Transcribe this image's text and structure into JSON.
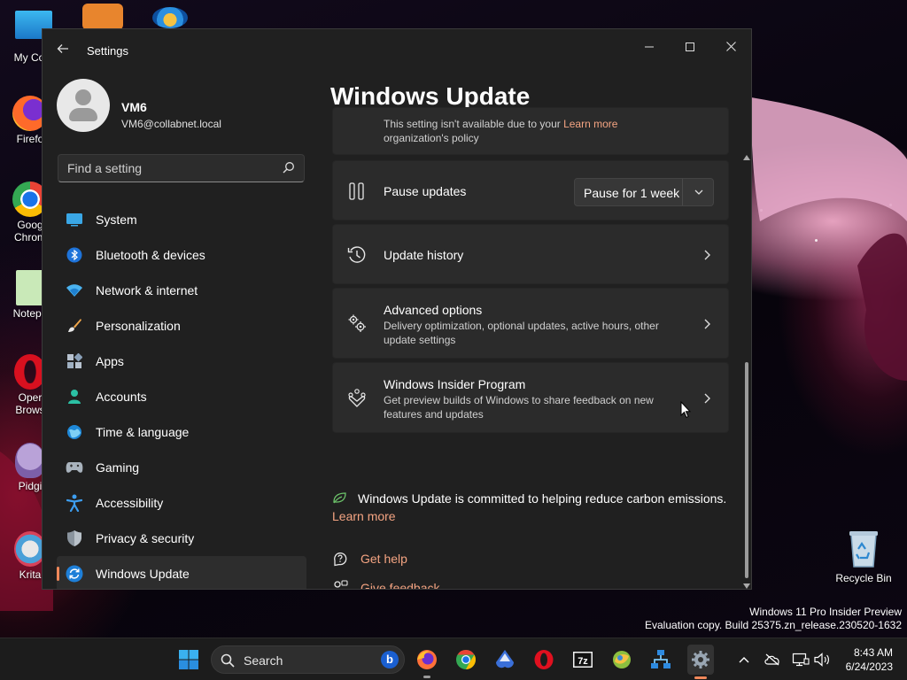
{
  "desktop": {
    "icons": [
      {
        "label": "My Com"
      },
      {
        "label": "Firefo"
      },
      {
        "label": "Goog Chrom"
      },
      {
        "label": "Notepa"
      },
      {
        "label": "Oper Brows"
      },
      {
        "label": "Pidgi"
      },
      {
        "label": "Krita"
      },
      {
        "label": "Recycle Bin"
      }
    ],
    "watermark": {
      "line1": "Windows 11 Pro Insider Preview",
      "line2": "Evaluation copy. Build 25375.zn_release.230520-1632"
    }
  },
  "window": {
    "title": "Settings",
    "controls": {
      "minimize": "minimize",
      "maximize": "maximize",
      "close": "close"
    }
  },
  "user": {
    "name": "VM6",
    "email": "VM6@collabnet.local"
  },
  "search": {
    "placeholder": "Find a setting"
  },
  "nav": [
    {
      "label": "System",
      "icon": "system-icon"
    },
    {
      "label": "Bluetooth & devices",
      "icon": "bluetooth-icon"
    },
    {
      "label": "Network & internet",
      "icon": "network-icon"
    },
    {
      "label": "Personalization",
      "icon": "brush-icon"
    },
    {
      "label": "Apps",
      "icon": "apps-icon"
    },
    {
      "label": "Accounts",
      "icon": "accounts-icon"
    },
    {
      "label": "Time & language",
      "icon": "globe-icon"
    },
    {
      "label": "Gaming",
      "icon": "gamepad-icon"
    },
    {
      "label": "Accessibility",
      "icon": "accessibility-icon"
    },
    {
      "label": "Privacy & security",
      "icon": "shield-icon"
    },
    {
      "label": "Windows Update",
      "icon": "update-icon",
      "active": true
    }
  ],
  "main": {
    "title": "Windows Update",
    "policy_notice": {
      "text_before_link": "This setting isn't available due to your",
      "link": "Learn more",
      "line2": "organization's policy"
    },
    "pause": {
      "title": "Pause updates",
      "dropdown_value": "Pause for 1 week"
    },
    "history": {
      "title": "Update history"
    },
    "advanced": {
      "title": "Advanced options",
      "desc": "Delivery optimization, optional updates, active hours, other update settings"
    },
    "insider": {
      "title": "Windows Insider Program",
      "desc": "Get preview builds of Windows to share feedback on new features and updates"
    },
    "carbon": {
      "text": "Windows Update is committed to helping reduce carbon emissions.",
      "link": "Learn more"
    },
    "help": {
      "get_help": "Get help",
      "give_feedback": "Give feedback"
    }
  },
  "taskbar": {
    "search_label": "Search",
    "bing_letter": "b",
    "apps": [
      "start-icon",
      "firefox-icon",
      "chrome-icon",
      "inkscape-icon",
      "opera-icon",
      "7zip-icon",
      "vlc-icon",
      "network-app-icon",
      "settings-icon"
    ],
    "clock": {
      "time": "8:43 AM",
      "date": "6/24/2023"
    }
  },
  "colors": {
    "accent": "#f0885a",
    "link": "#f4a482",
    "window_bg": "#202020",
    "card_bg": "#2b2b2b"
  }
}
